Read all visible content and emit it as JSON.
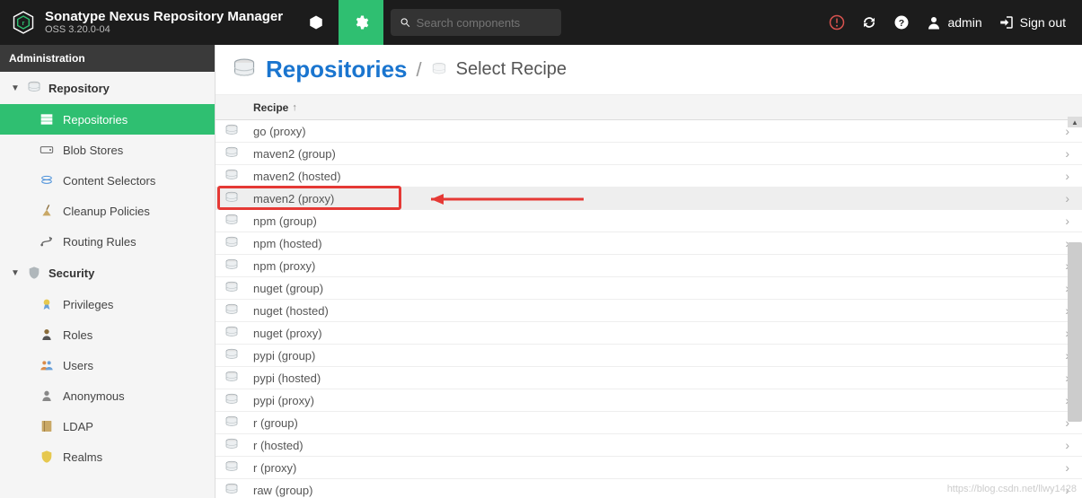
{
  "header": {
    "app_title": "Sonatype Nexus Repository Manager",
    "app_version": "OSS 3.20.0-04",
    "search_placeholder": "Search components",
    "username": "admin",
    "signout": "Sign out"
  },
  "adminbar": {
    "label": "Administration"
  },
  "sidebar": {
    "groups": [
      {
        "label": "Repository",
        "items": [
          {
            "label": "Repositories",
            "active": true
          },
          {
            "label": "Blob Stores"
          },
          {
            "label": "Content Selectors"
          },
          {
            "label": "Cleanup Policies"
          },
          {
            "label": "Routing Rules"
          }
        ]
      },
      {
        "label": "Security",
        "items": [
          {
            "label": "Privileges"
          },
          {
            "label": "Roles"
          },
          {
            "label": "Users"
          },
          {
            "label": "Anonymous"
          },
          {
            "label": "LDAP"
          },
          {
            "label": "Realms"
          }
        ]
      }
    ]
  },
  "breadcrumb": {
    "title": "Repositories",
    "subtitle": "Select Recipe"
  },
  "table": {
    "header": "Recipe",
    "rows": [
      {
        "label": "go (proxy)"
      },
      {
        "label": "maven2 (group)"
      },
      {
        "label": "maven2 (hosted)"
      },
      {
        "label": "maven2 (proxy)",
        "highlighted": true
      },
      {
        "label": "npm (group)"
      },
      {
        "label": "npm (hosted)"
      },
      {
        "label": "npm (proxy)"
      },
      {
        "label": "nuget (group)"
      },
      {
        "label": "nuget (hosted)"
      },
      {
        "label": "nuget (proxy)"
      },
      {
        "label": "pypi (group)"
      },
      {
        "label": "pypi (hosted)"
      },
      {
        "label": "pypi (proxy)"
      },
      {
        "label": "r (group)"
      },
      {
        "label": "r (hosted)"
      },
      {
        "label": "r (proxy)"
      },
      {
        "label": "raw (group)"
      }
    ]
  },
  "watermark": "https://blog.csdn.net/llwy1428"
}
